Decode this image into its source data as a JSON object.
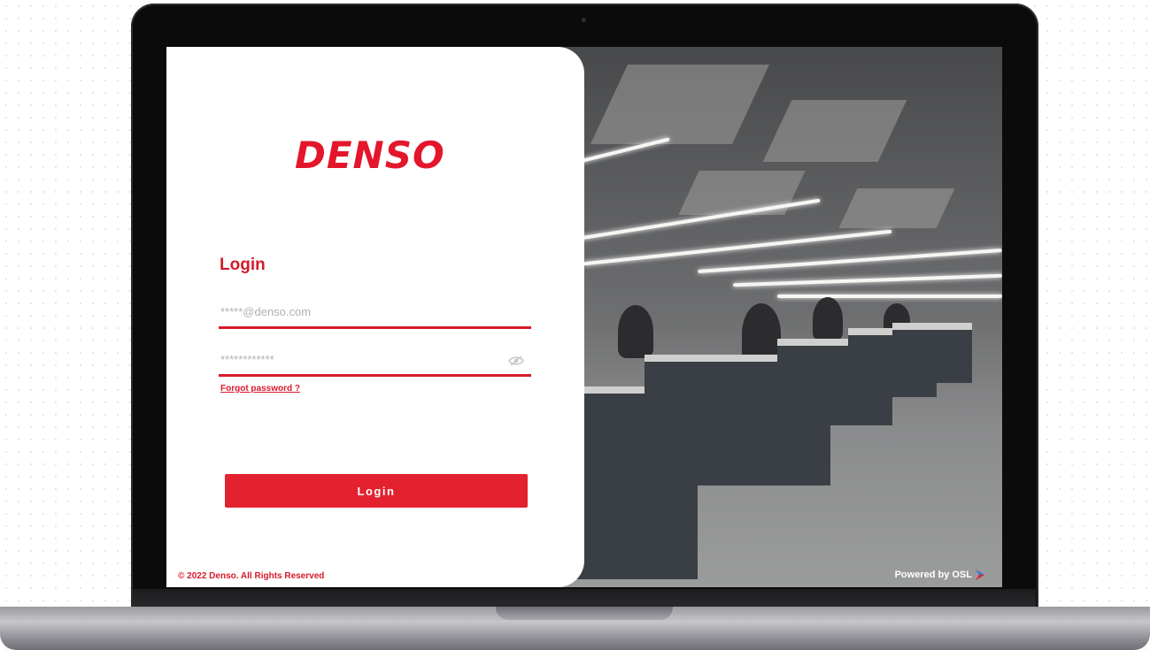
{
  "brand": {
    "name": "DENSO",
    "color": "#e3162b"
  },
  "login": {
    "title": "Login",
    "email_placeholder": "*****@denso.com",
    "password_placeholder": "************",
    "forgot_password": "Forgot password ?",
    "submit_label": "Login",
    "accent_color": "#d71a2a",
    "password_toggle_icon": "eye-slash-icon"
  },
  "footer": {
    "copyright": "© 2022 Denso. All Rights Reserved",
    "powered_by": "Powered by OSL",
    "osl_logo_icon": "osl-logo-icon"
  }
}
